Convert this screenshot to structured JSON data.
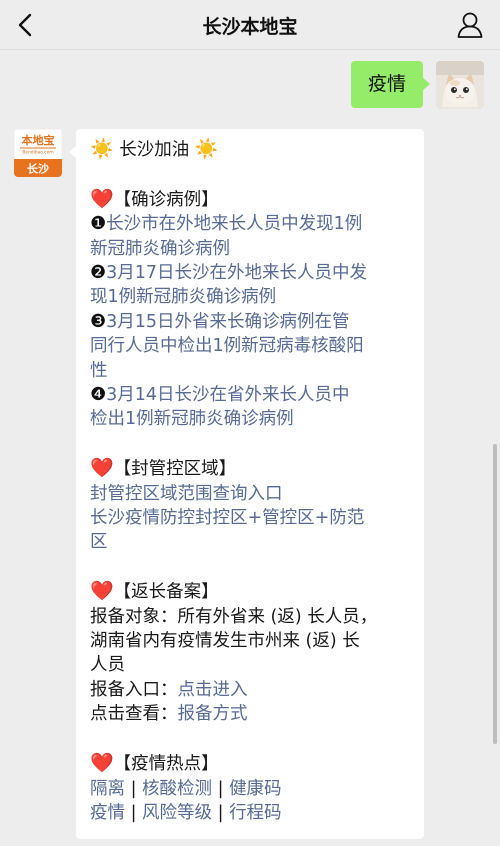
{
  "header": {
    "title": "长沙本地宝"
  },
  "outgoing": {
    "text": "疫情"
  },
  "bot_avatar": {
    "brand_text": "本地宝",
    "brand_url": "Bendibao.com",
    "city": "长沙"
  },
  "reply": {
    "greeting_sun_left": "☀️",
    "greeting": "长沙加油",
    "greeting_sun_right": "☀️",
    "heart": "❤️",
    "confirmed": {
      "title": "【确诊病例】",
      "items": [
        {
          "num": "❶",
          "line1": "长沙市在外地来长人员中发现1例",
          "line2": "新冠肺炎确诊病例"
        },
        {
          "num": "❷",
          "line1": "3月17日长沙在外地来长人员中发",
          "line2": "现1例新冠肺炎确诊病例"
        },
        {
          "num": "❸",
          "line1": "3月15日外省来长确诊病例在管",
          "line2": "同行人员中检出1例新冠病毒核酸阳",
          "line3": "性"
        },
        {
          "num": "❹",
          "line1": "3月14日长沙在省外来长人员中",
          "line2": "检出1例新冠肺炎确诊病例"
        }
      ]
    },
    "control": {
      "title": "【封管控区域】",
      "link1": "封管控区域范围查询入口",
      "link2_line1": "长沙疫情防控封控区+管控区+防范",
      "link2_line2": "区"
    },
    "return": {
      "title": "【返长备案】",
      "target_line1": "报备对象：所有外省来 (返) 长人员，",
      "target_line2": "湖南省内有疫情发生市州来 (返) 长",
      "target_line3": "人员",
      "entry_label": "报备入口：",
      "entry_link": "点击进入",
      "view_label": "点击查看：",
      "view_link": "报备方式"
    },
    "hot": {
      "title": "【疫情热点】",
      "row1": [
        "隔离",
        "核酸检测",
        "健康码"
      ],
      "row2": [
        "疫情",
        "风险等级",
        "行程码"
      ],
      "separator": " | "
    }
  },
  "colors": {
    "background": "#ededed",
    "bubble_out": "#95ec69",
    "bubble_in": "#ffffff",
    "link": "#576b95",
    "brand_orange": "#e8731e"
  }
}
